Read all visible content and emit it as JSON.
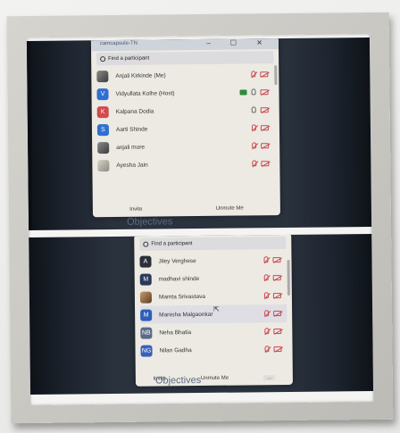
{
  "top_window": {
    "app_title": "camcapsule-TN",
    "window_controls": "– ☐ ✕",
    "search": {
      "placeholder": "Find a participant"
    },
    "participants": [
      {
        "initial": "",
        "name": "Anjali Kirkinde (Me)",
        "avatar_color": "#6c6c6c",
        "mic": "off",
        "cam": "off",
        "share": false
      },
      {
        "initial": "V",
        "name": "Vidyullata Kolhe (Host)",
        "avatar_color": "#2f6fd1",
        "mic": "on",
        "cam": "off",
        "share": true
      },
      {
        "initial": "K",
        "name": "Kalpana Dodia",
        "avatar_color": "#d14b4b",
        "mic": "on",
        "cam": "off",
        "share": false
      },
      {
        "initial": "S",
        "name": "Aarti Shinde",
        "avatar_color": "#2f6fd1",
        "mic": "off",
        "cam": "off",
        "share": false
      },
      {
        "initial": "",
        "name": "anjali more",
        "avatar_color": "#777777",
        "mic": "off",
        "cam": "off",
        "share": false
      },
      {
        "initial": "",
        "name": "Ayesha Jain",
        "avatar_color": "#999999",
        "mic": "off",
        "cam": "off",
        "share": false
      }
    ],
    "footer": {
      "invite": "Invite",
      "unmute": "Unmute Me"
    },
    "background_text": "Objectives"
  },
  "bottom_window": {
    "search": {
      "placeholder": "Find a participant"
    },
    "participants": [
      {
        "initial": "A",
        "name": "Jiley Verghese",
        "avatar_color": "#2a2f3a",
        "mic": "off",
        "cam": "off",
        "highlighted": false
      },
      {
        "initial": "M",
        "name": "madhavi shinde",
        "avatar_color": "#2a3a5a",
        "mic": "off",
        "cam": "off",
        "highlighted": false
      },
      {
        "initial": "",
        "name": "Mamta Srivastava",
        "avatar_color": "#c9934f",
        "mic": "off",
        "cam": "off",
        "highlighted": false
      },
      {
        "initial": "M",
        "name": "Manisha Malgaonkar",
        "avatar_color": "#2f5fb8",
        "mic": "off",
        "cam": "off",
        "highlighted": true
      },
      {
        "initial": "NB",
        "name": "Neha Bhatia",
        "avatar_color": "#5a6a8a",
        "mic": "off",
        "cam": "off",
        "highlighted": false
      },
      {
        "initial": "NG",
        "name": "Nilan Gadha",
        "avatar_color": "#3a5fb8",
        "mic": "off",
        "cam": "off",
        "highlighted": false
      }
    ],
    "footer": {
      "invite": "Invite",
      "unmute": "Unmute Me",
      "more": "..."
    },
    "background_text": "Objectives"
  }
}
